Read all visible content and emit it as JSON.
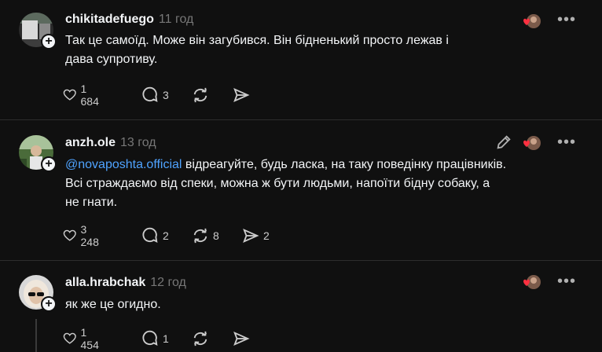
{
  "posts": [
    {
      "username": "chikitadefuego",
      "time": "11 год",
      "text": "Так це самоїд. Може він загубився. Він бідненький просто лежав і дава супротиву.",
      "text_line1": "Так це самоїд. Може він загубився. Він бідненький просто лежав і",
      "text_line2": "дава супротиву.",
      "likes": "1 684",
      "replies": "3",
      "reposts": "",
      "shares": ""
    },
    {
      "username": "anzh.ole",
      "time": "13 год",
      "mention": "@novaposhta.official",
      "text_line1_after": " відреагуйте, будь ласка, на таку поведінку працівників.",
      "text_line2": "Всі страждаємо від спеки, можна ж бути людьми, напоїти бідну собаку, а",
      "text_line3": "не гнати.",
      "likes": "3 248",
      "replies": "2",
      "reposts": "8",
      "shares": "2"
    },
    {
      "username": "alla.hrabchak",
      "time": "12 год",
      "text": "як же це огидно.",
      "likes": "1 454",
      "replies": "1",
      "reposts": "",
      "shares": ""
    }
  ],
  "icons": {
    "like": "heart-outline-icon",
    "reply": "comment-bubble-icon",
    "repost": "repost-arrows-icon",
    "share": "send-paper-plane-icon",
    "more": "more-dots-icon",
    "edit": "pencil-icon"
  },
  "colors": {
    "background": "#101010",
    "text": "#f3f5f7",
    "secondary": "#777777",
    "mention": "#4fa3ff",
    "heart": "#ff3040"
  },
  "badge_symbol": "+",
  "more_symbol": "•••"
}
